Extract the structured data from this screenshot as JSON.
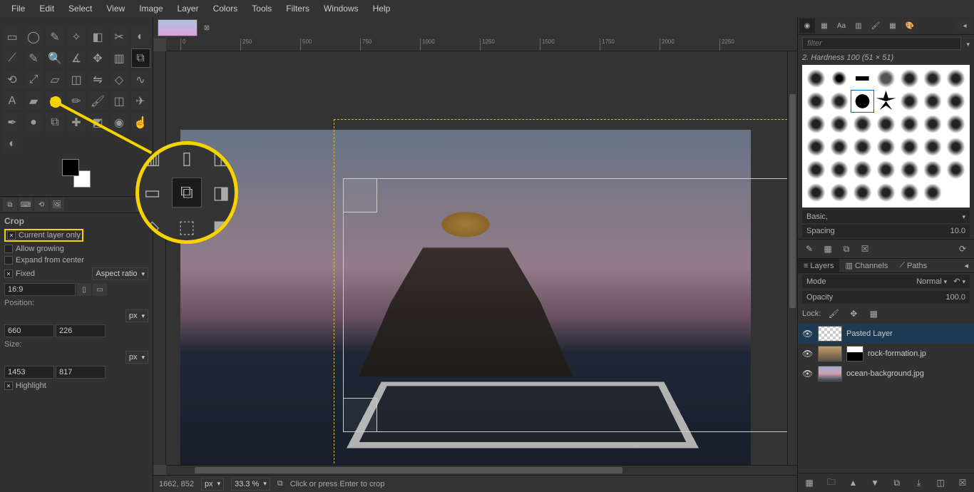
{
  "menubar": [
    "File",
    "Edit",
    "Select",
    "View",
    "Image",
    "Layer",
    "Colors",
    "Tools",
    "Filters",
    "Windows",
    "Help"
  ],
  "tool_options": {
    "title": "Crop",
    "current_layer_only": "Current layer only",
    "current_layer_only_checked": true,
    "allow_growing": "Allow growing",
    "allow_growing_checked": false,
    "expand_from_center": "Expand from center",
    "expand_from_center_checked": false,
    "fixed_label": "Fixed",
    "fixed_checked": true,
    "fixed_mode": "Aspect ratio",
    "ratio_value": "16:9",
    "position_label": "Position:",
    "position_unit": "px",
    "position_x": "660",
    "position_y": "226",
    "size_label": "Size:",
    "size_unit": "px",
    "size_w": "1453",
    "size_h": "817",
    "highlight_label": "Highlight",
    "highlight_checked": true
  },
  "status": {
    "coords": "1662, 852",
    "unit": "px",
    "zoom": "33.3 %",
    "hint": "Click or press Enter to crop"
  },
  "ruler_ticks": [
    0,
    250,
    500,
    750,
    1000,
    1250,
    1500,
    1750,
    2000,
    2250
  ],
  "right": {
    "filter_placeholder": "filter",
    "brush_label": "2. Hardness 100 (51 × 51)",
    "basic_label": "Basic,",
    "spacing_label": "Spacing",
    "spacing_value": "10.0",
    "tabs": {
      "layers": "Layers",
      "channels": "Channels",
      "paths": "Paths"
    },
    "mode_label": "Mode",
    "mode_value": "Normal",
    "opacity_label": "Opacity",
    "opacity_value": "100.0",
    "lock_label": "Lock:",
    "layers": [
      {
        "name": "Pasted Layer",
        "selected": true,
        "visible": true,
        "thumb": "checker",
        "mask": false
      },
      {
        "name": "rock-formation.jp",
        "selected": false,
        "visible": true,
        "thumb": "rock",
        "mask": true
      },
      {
        "name": "ocean-background.jpg",
        "selected": false,
        "visible": true,
        "thumb": "ocean",
        "mask": false
      }
    ]
  }
}
